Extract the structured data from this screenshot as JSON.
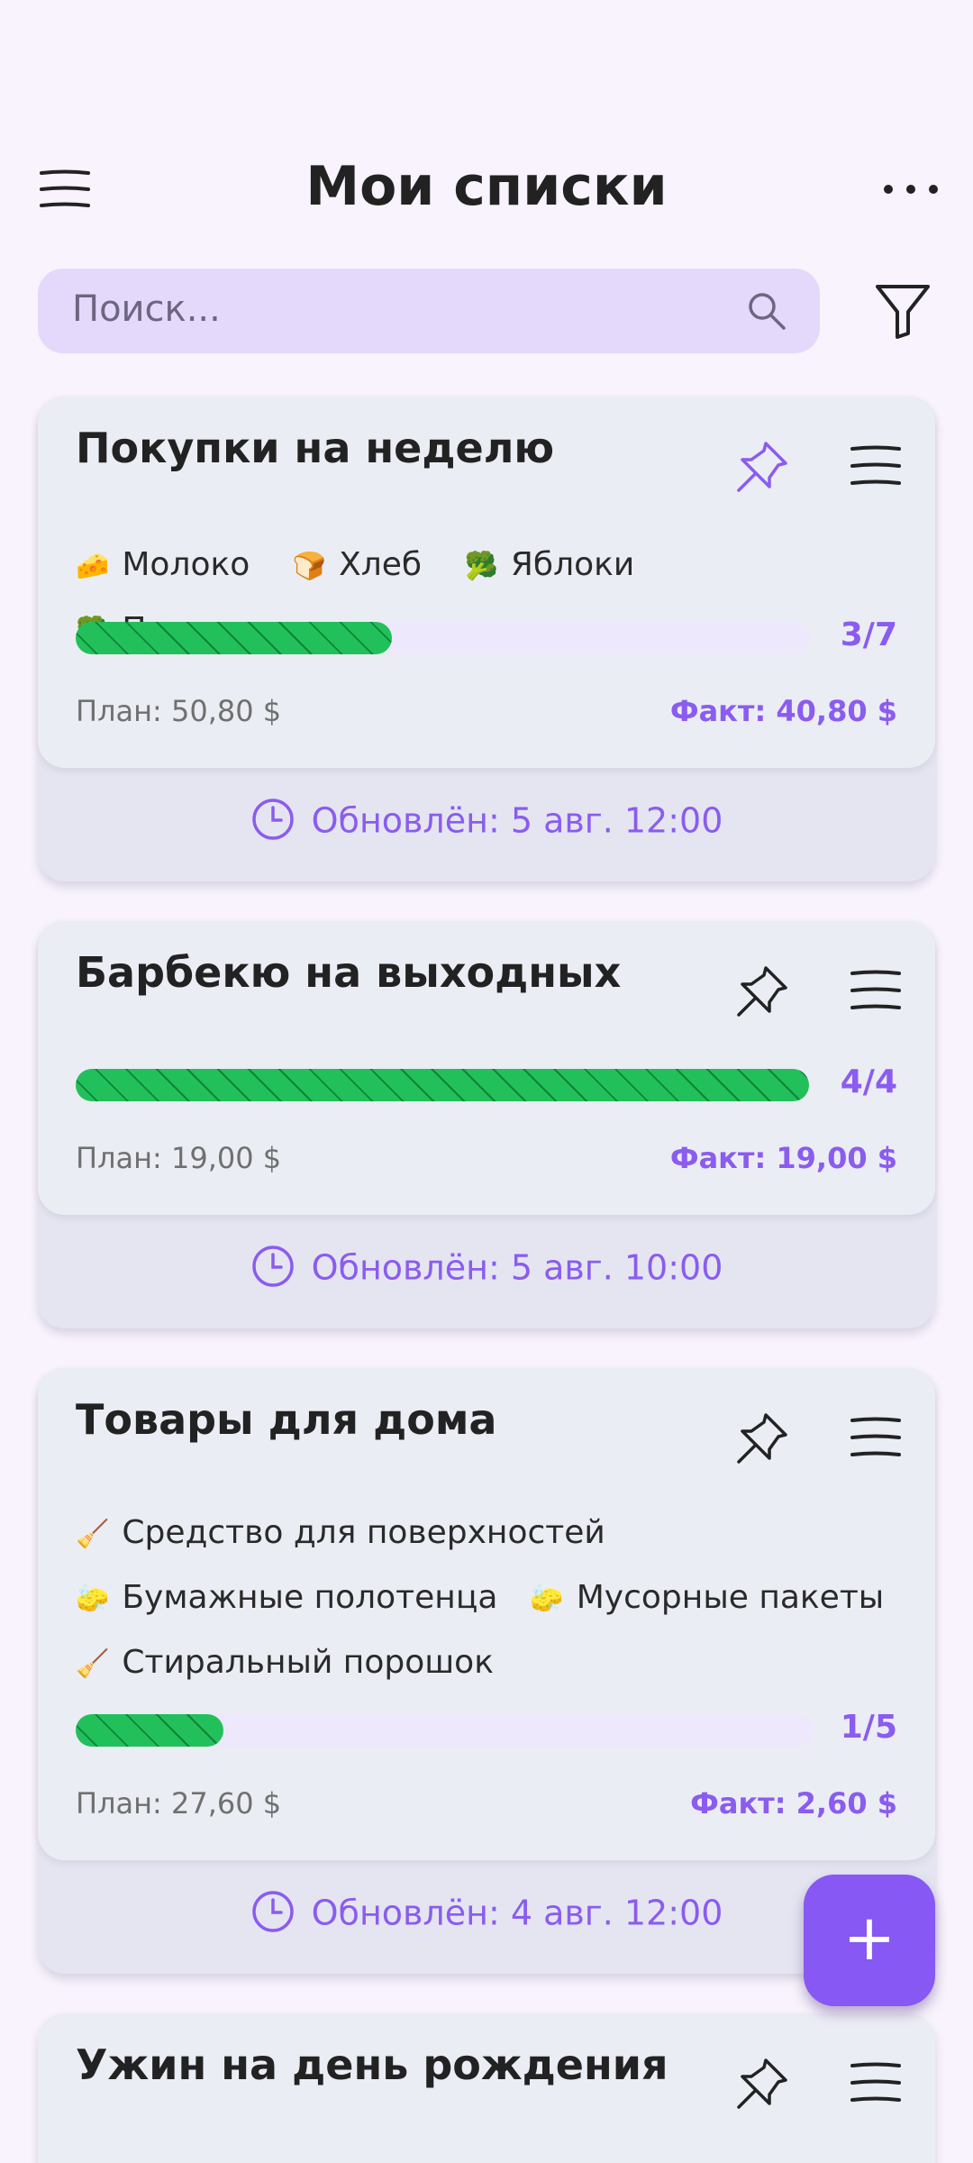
{
  "header": {
    "title": "Мои списки"
  },
  "search": {
    "placeholder": "Поиск..."
  },
  "colors": {
    "accent": "#8a5cf0",
    "progress": "#22c05a",
    "search_bg": "#e4d8fb"
  },
  "lists": [
    {
      "title": "Покупки на неделю",
      "pinned": true,
      "items": [
        {
          "emoji": "🧀",
          "label": "Молоко"
        },
        {
          "emoji": "🍞",
          "label": "Хлеб"
        },
        {
          "emoji": "🥦",
          "label": "Яблоки"
        },
        {
          "emoji": "🥦",
          "label": "Помидоры"
        }
      ],
      "count": "3/7",
      "progress": 0.43,
      "plan": "План: 50,80 $",
      "fact": "Факт: 40,80 $",
      "updated": "Обновлён: 5 авг. 12:00"
    },
    {
      "title": "Барбекю на выходных",
      "pinned": false,
      "items": [],
      "count": "4/4",
      "progress": 1.0,
      "plan": "План: 19,00 $",
      "fact": "Факт: 19,00 $",
      "updated": "Обновлён: 5 авг. 10:00"
    },
    {
      "title": "Товары для дома",
      "pinned": false,
      "items": [
        {
          "emoji": "🧹",
          "label": "Средство для поверхностей"
        },
        {
          "emoji": "🧽",
          "label": "Бумажные полотенца"
        },
        {
          "emoji": "🧽",
          "label": "Мусорные пакеты"
        },
        {
          "emoji": "🧹",
          "label": "Стиральный порошок"
        }
      ],
      "count": "1/5",
      "progress": 0.2,
      "plan": "План: 27,60 $",
      "fact": "Факт: 2,60 $",
      "updated": "Обновлён: 4 авг. 12:00"
    },
    {
      "title": "Ужин на день рождения",
      "pinned": false
    }
  ],
  "fab": {
    "label": "+"
  },
  "icons": [
    "menu-icon",
    "more-icon",
    "search-icon",
    "filter-icon",
    "pin-icon",
    "list-icon",
    "clock-icon",
    "plus-icon"
  ]
}
